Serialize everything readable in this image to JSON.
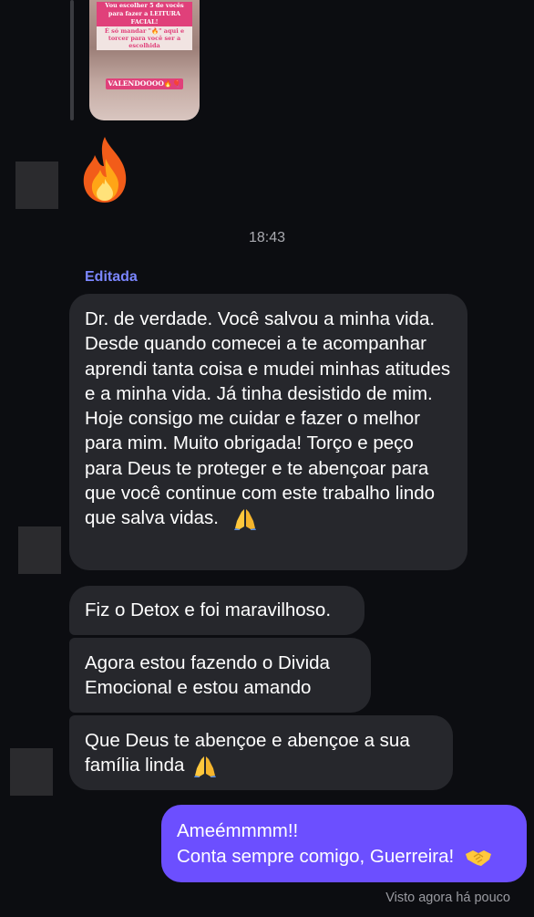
{
  "story_reply": {
    "line1": "Vou escolher 5 de vocês para fazer a LEITURA FACIAL!",
    "line2": "É só mandar \"🔥\" aqui e torcer para você ser a escolhida",
    "cta": "VALENDOOOO🔥🎈"
  },
  "reaction_emoji": "fire-emoji",
  "timestamp": "18:43",
  "edited_label": "Editada",
  "messages_in": [
    {
      "text": "Dr. de verdade. Você salvou a minha vida. Desde quando comecei a te acompanhar aprendi tanta coisa e mudei minhas atitudes e a minha vida. Já tinha desistido de mim. Hoje consigo me cuidar e fazer o melhor para mim. Muito obrigada! Torço e peço para Deus te proteger e te abençoar para que você continue com este trabalho lindo que salva vidas.",
      "emoji": "praying-hands-emoji"
    },
    {
      "text": "Fiz o Detox e foi maravilhoso."
    },
    {
      "text": "Agora estou fazendo o Divida Emocional e estou amando"
    },
    {
      "text": "Que Deus te abençoe e abençoe a sua família linda",
      "emoji": "praying-hands-emoji"
    }
  ],
  "message_out": {
    "line1": "Ameémmmm!!",
    "line2": "Conta sempre comigo, Guerreira!",
    "emoji": "handshake-emoji"
  },
  "seen_status": "Visto agora há pouco",
  "colors": {
    "background": "#0c0d11",
    "incoming_bubble": "#26272c",
    "outgoing_bubble": "#6c4fff",
    "edited_label": "#7b86ff"
  }
}
